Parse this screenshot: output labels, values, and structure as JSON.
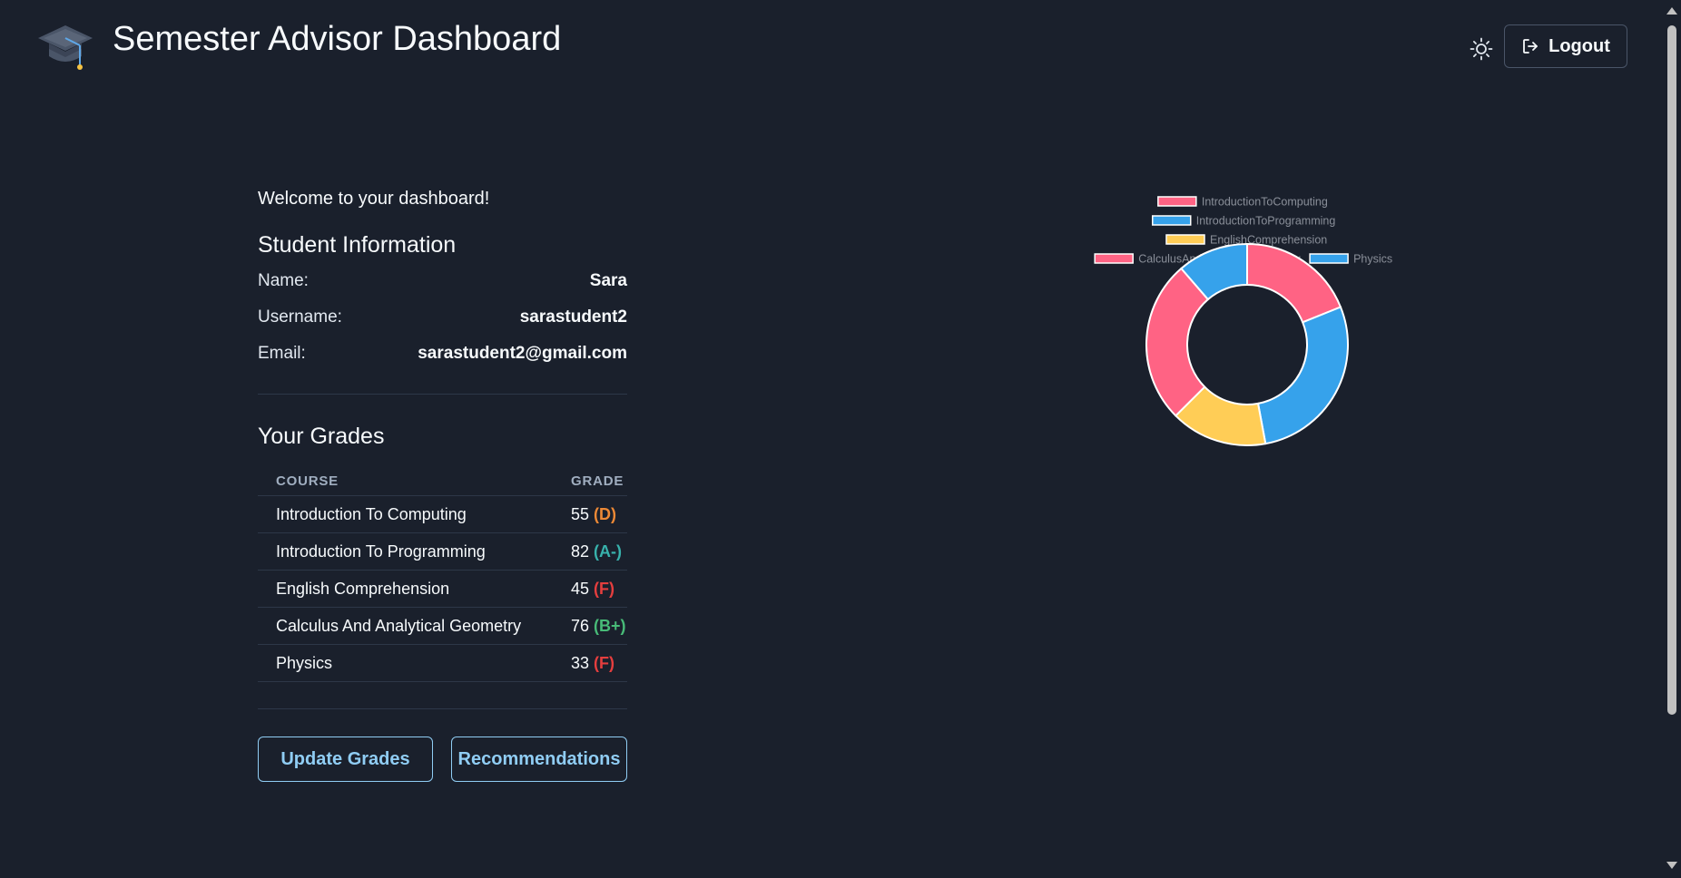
{
  "header": {
    "title": "Semester Advisor Dashboard",
    "logout_label": "Logout"
  },
  "welcome": "Welcome to your dashboard!",
  "student_info": {
    "title": "Student Information",
    "name_label": "Name:",
    "name": "Sara",
    "username_label": "Username:",
    "username": "sarastudent2",
    "email_label": "Email:",
    "email": "sarastudent2@gmail.com"
  },
  "grades": {
    "title": "Your Grades",
    "col_course": "COURSE",
    "col_grade": "GRADE",
    "rows": [
      {
        "course": "Introduction To Computing",
        "score": "55",
        "letter": "(D)",
        "color": "#ed8936"
      },
      {
        "course": "Introduction To Programming",
        "score": "82",
        "letter": "(A-)",
        "color": "#38b2ac"
      },
      {
        "course": "English Comprehension",
        "score": "45",
        "letter": "(F)",
        "color": "#e53e3e"
      },
      {
        "course": "Calculus And Analytical Geometry",
        "score": "76",
        "letter": "(B+)",
        "color": "#48bb78"
      },
      {
        "course": "Physics",
        "score": "33",
        "letter": "(F)",
        "color": "#e53e3e"
      }
    ]
  },
  "buttons": {
    "update": "Update Grades",
    "recommendations": "Recommendations"
  },
  "chart_data": {
    "type": "pie",
    "variant": "doughnut",
    "legend_position": "top",
    "categories": [
      "IntroductionToComputing",
      "IntroductionToProgramming",
      "EnglishComprehension",
      "CalculusAndAnalyticalGeometry",
      "Physics"
    ],
    "values": [
      55,
      82,
      45,
      76,
      33
    ],
    "colors": [
      "#ff6384",
      "#36a2eb",
      "#ffcd56",
      "#ff6384",
      "#36a2eb"
    ]
  },
  "colors": {
    "background": "#1a202c",
    "accent": "#90cdf4"
  }
}
